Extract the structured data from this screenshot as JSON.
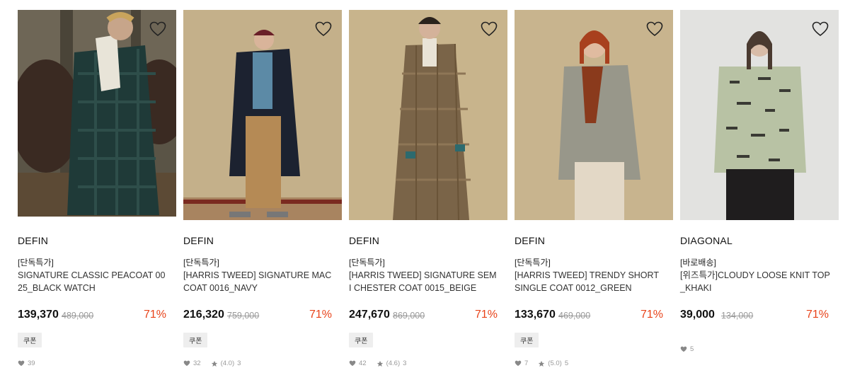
{
  "products": [
    {
      "brand": "DEFIN",
      "tag": "[단독특가]",
      "name": "SIGNATURE CLASSIC PEACOAT 0025_BLACK WATCH",
      "price": "139,370",
      "original_price": "489,000",
      "discount": "71%",
      "coupon": "쿠폰",
      "likes": "39",
      "rating": "",
      "reviews": ""
    },
    {
      "brand": "DEFIN",
      "tag": "[단독특가]",
      "name": "[HARRIS TWEED] SIGNATURE MAC COAT 0016_NAVY",
      "price": "216,320",
      "original_price": "759,000",
      "discount": "71%",
      "coupon": "쿠폰",
      "likes": "32",
      "rating": "(4.0)",
      "reviews": "3"
    },
    {
      "brand": "DEFIN",
      "tag": "[단독특가]",
      "name": "[HARRIS TWEED] SIGNATURE SEMI CHESTER COAT 0015_BEIGE",
      "price": "247,670",
      "original_price": "869,000",
      "discount": "71%",
      "coupon": "쿠폰",
      "likes": "42",
      "rating": "(4.6)",
      "reviews": "3"
    },
    {
      "brand": "DEFIN",
      "tag": "[단독특가]",
      "name": "[HARRIS TWEED] TRENDY SHORT SINGLE COAT 0012_GREEN",
      "price": "133,670",
      "original_price": "469,000",
      "discount": "71%",
      "coupon": "쿠폰",
      "likes": "7",
      "rating": "(5.0)",
      "reviews": "5"
    },
    {
      "brand": "DIAGONAL",
      "tag": "[바로배송]",
      "name": "[위즈특가]CLOUDY LOOSE KNIT TOP_KHAKI",
      "price": "39,000",
      "original_price": "134,000",
      "discount": "71%",
      "coupon": "",
      "likes": "5",
      "rating": "",
      "reviews": ""
    }
  ],
  "colors": {
    "discount": "#e8431a",
    "coupon_bg": "#eeeeee",
    "muted": "#999999"
  },
  "icons": {
    "wishlist": "heart-outline-icon",
    "likes": "heart-icon",
    "rating": "star-icon"
  }
}
